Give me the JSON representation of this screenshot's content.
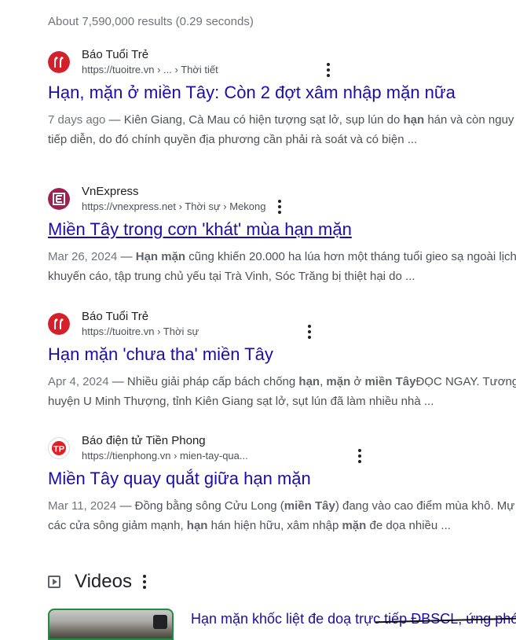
{
  "stats": "About 7,590,000 results (0.29 seconds)",
  "results": [
    {
      "site_name": "Báo Tuổi Trẻ",
      "url": "https://tuoitre.vn › ... › Thời tiết",
      "title": "Hạn, mặn ở miền Tây: Còn 2 đợt xâm nhập mặn nữa",
      "snippet_line1": {
        "date": "7 days ago",
        "parts": [
          " — Kiên Giang, Cà Mau có hiện tượng sạt lở, sụp lún do ",
          "hạn",
          " hán và còn nguy"
        ]
      },
      "snippet_line2": "tiếp diễn, do đó chính quyền địa phương cần phải rà soát và có biện ...",
      "favicon": "tuoitre-logo-icon"
    },
    {
      "site_name": "VnExpress",
      "url": "https://vnexpress.net › Thời sự › Mekong",
      "title": "Miền Tây trong cơn 'khát' mùa hạn mặn",
      "snippet_line1": {
        "date": "Mar 26, 2024",
        "parts": [
          " — ",
          "Hạn mặn",
          " cũng khiến 20.000 ha lúa hơn một tháng tuổi gieo sạ ngoài lịch"
        ]
      },
      "snippet_line2": "khuyến cáo, tập trung chủ yếu tại Trà Vinh, Sóc Trăng bị thiệt hại do ...",
      "favicon": "vnexpress-logo-icon"
    },
    {
      "site_name": "Báo Tuổi Trẻ",
      "url": "https://tuoitre.vn › Thời sự",
      "title": "Hạn mặn 'chưa tha' miền Tây",
      "snippet_line1": {
        "date": "Apr 4, 2024",
        "parts": [
          " — Nhiều giải pháp cấp bách chống ",
          "hạn",
          ", ",
          "mặn",
          " ở ",
          "miền Tây",
          "ĐỌC NGAY. Tương"
        ]
      },
      "snippet_line2": "huyện U Minh Thượng, tỉnh Kiên Giang sạt lở, sụt lún đã làm nhiều nhà ...",
      "favicon": "tuoitre-logo-icon"
    },
    {
      "site_name": "Báo điện tử Tiền Phong",
      "url": "https://tienphong.vn › mien-tay-qua...",
      "title": "Miền Tây quay quắt giữa hạn mặn",
      "snippet_line1": {
        "date": "Mar 11, 2024",
        "parts": [
          " — Đồng bằng sông Cửu Long (",
          "miền Tây",
          ") đang vào cao điểm mùa khô. Mự"
        ]
      },
      "snippet_line2_parts": [
        "các cửa sông giảm mạnh, ",
        "hạn",
        " hán hiện hữu, xâm nhập ",
        "mặn",
        " đe dọa nhiều ..."
      ],
      "favicon": "tienphong-logo-icon",
      "favicon_text": "TP"
    }
  ],
  "videos": {
    "label": "Videos",
    "first_video_title": "Hạn mặn khốc liệt đe doạ trực tiếp ĐBSCL, ứng phó t"
  },
  "colors": {
    "link": "#1a0dab",
    "tuoitre_red": "#d4202a",
    "vnexpress_maroon": "#9f224e",
    "tienphong_red": "#e31e24"
  }
}
